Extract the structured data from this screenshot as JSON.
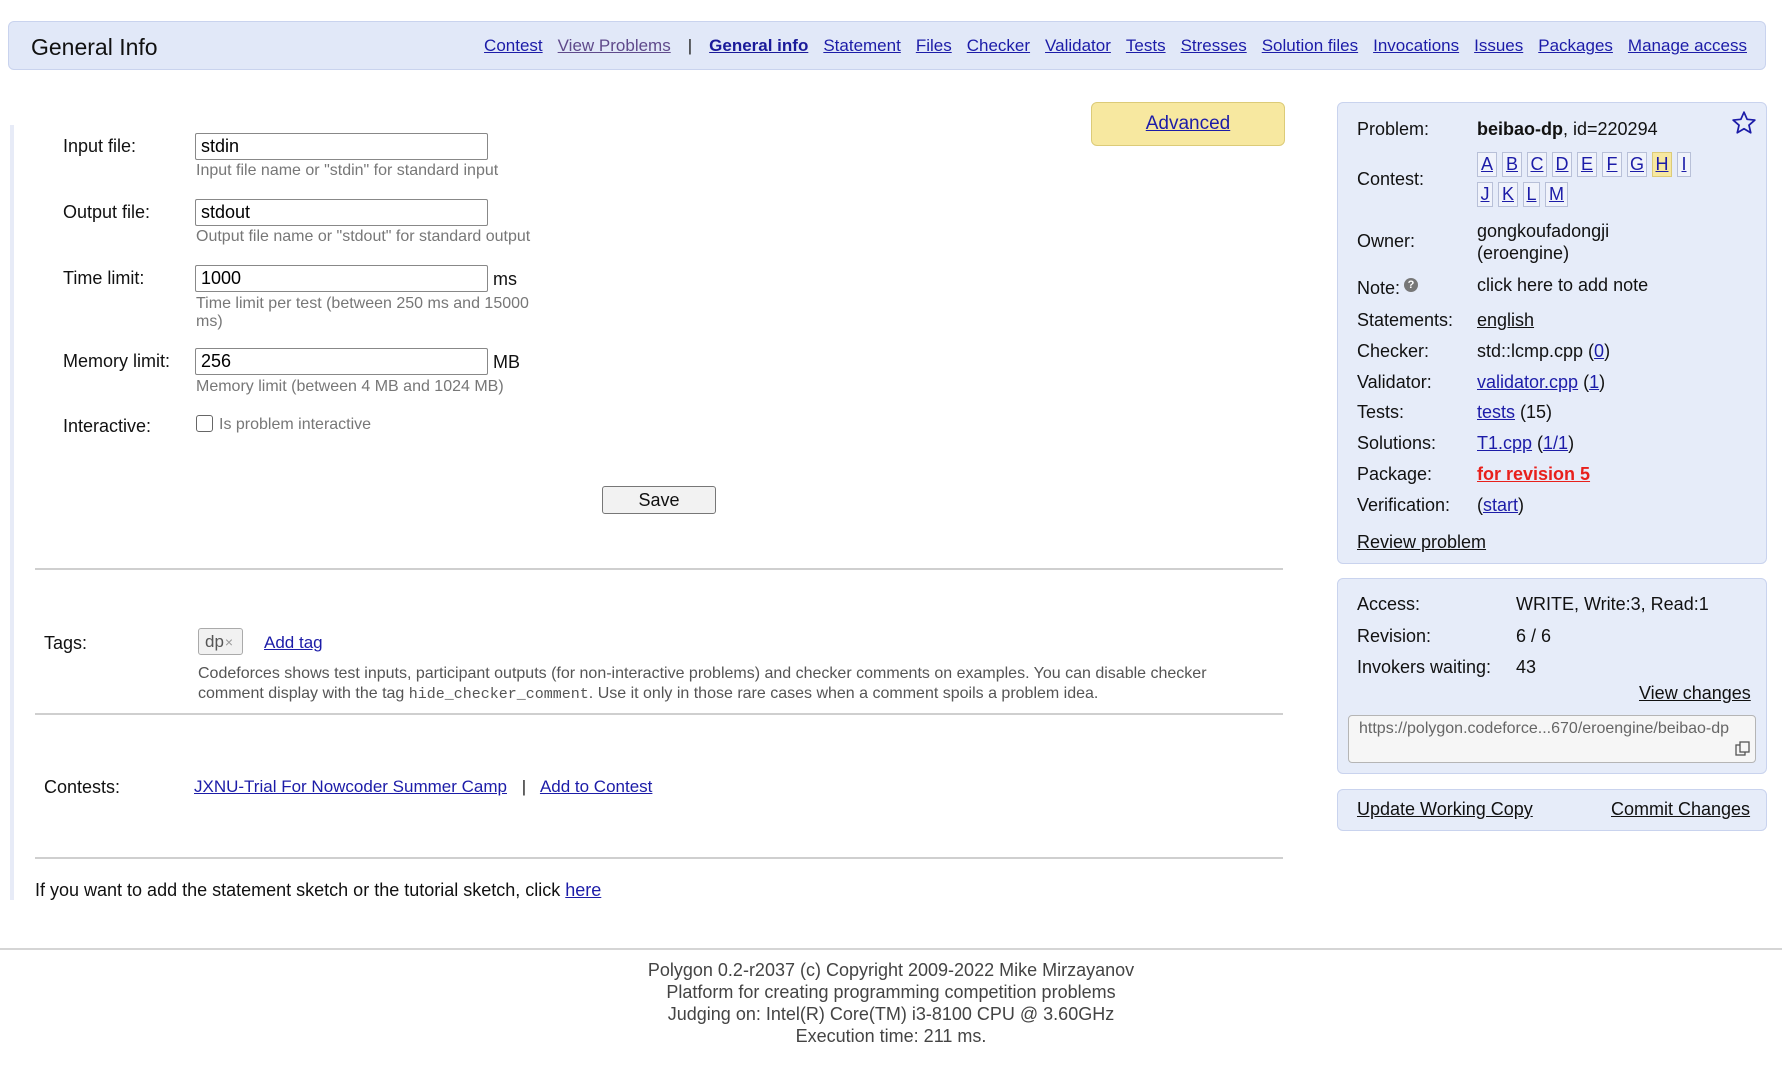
{
  "header": {
    "title": "General Info",
    "nav": {
      "contest": "Contest",
      "view_problems": "View Problems",
      "sep": "|",
      "general_info": "General info",
      "statement": "Statement",
      "files": "Files",
      "checker": "Checker",
      "validator": "Validator",
      "tests": "Tests",
      "stresses": "Stresses",
      "solution_files": "Solution files",
      "invocations": "Invocations",
      "issues": "Issues",
      "packages": "Packages",
      "manage_access": "Manage access"
    }
  },
  "advanced_label": "Advanced",
  "form": {
    "input_file": {
      "label": "Input file:",
      "value": "stdin",
      "hint": "Input file name or \"stdin\" for standard input"
    },
    "output_file": {
      "label": "Output file:",
      "value": "stdout",
      "hint": "Output file name or \"stdout\" for standard output"
    },
    "time_limit": {
      "label": "Time limit:",
      "value": "1000",
      "unit": "ms",
      "hint_line1": "Time limit per test (between 250 ms and 15000",
      "hint_line2": "ms)"
    },
    "memory_limit": {
      "label": "Memory limit:",
      "value": "256",
      "unit": "MB",
      "hint": "Memory limit (between 4 MB and 1024 MB)"
    },
    "interactive": {
      "label": "Interactive:",
      "checkbox_label": "Is problem interactive",
      "checked": false
    },
    "save_label": "Save"
  },
  "tags": {
    "label": "Tags:",
    "items": [
      {
        "name": "dp",
        "remove": "×"
      }
    ],
    "add_tag": "Add tag",
    "desc_before": "Codeforces shows test inputs, participant outputs (for non-interactive problems) and checker comments on examples. You can disable checker",
    "desc_line2_before": "comment display with the tag ",
    "desc_code": "hide_checker_comment",
    "desc_after": ". Use it only in those rare cases when a comment spoils a problem idea."
  },
  "contests": {
    "label": "Contests:",
    "contest_name": "JXNU-Trial For Nowcoder Summer Camp",
    "sep": "|",
    "add_to_contest": "Add to Contest"
  },
  "sketch": {
    "text": "If you want to add the statement sketch or the tutorial sketch, click ",
    "link": "here"
  },
  "sidebar": {
    "problem": {
      "label": "Problem:",
      "name": "beibao-dp",
      "id_text": ", id=220294"
    },
    "contest": {
      "label": "Contest:",
      "letters_row1": [
        "A",
        "B",
        "C",
        "D",
        "E",
        "F",
        "G",
        "H",
        "I"
      ],
      "letters_row2": [
        "J",
        "K",
        "L",
        "M"
      ],
      "current": "H"
    },
    "owner": {
      "label": "Owner:",
      "line1": "gongkoufadongji",
      "line2": "(eroengine)"
    },
    "note": {
      "label": "Note:",
      "help": "?",
      "link": "click here to add note"
    },
    "statements": {
      "label": "Statements:",
      "link": "english"
    },
    "checker": {
      "label": "Checker:",
      "text": "std::lcmp.cpp (",
      "link": "0",
      "close": ")"
    },
    "validator": {
      "label": "Validator:",
      "link": "validator.cpp",
      "open": " (",
      "count": "1",
      "close": ")"
    },
    "tests": {
      "label": "Tests:",
      "link": "tests",
      "rest": " (15)"
    },
    "solutions": {
      "label": "Solutions:",
      "link": "T1.cpp",
      "open": " (",
      "count": "1/1",
      "close": ")"
    },
    "package": {
      "label": "Package:",
      "link": "for revision 5"
    },
    "verification": {
      "label": "Verification:",
      "open": "(",
      "link": "start",
      "close": ")"
    },
    "review": "Review problem",
    "access": {
      "label": "Access:",
      "value": "WRITE, Write:3, Read:1"
    },
    "revision": {
      "label": "Revision:",
      "value": "6 / 6"
    },
    "invokers": {
      "label": "Invokers waiting:",
      "value": "43"
    },
    "view_changes": "View changes",
    "url": "https://polygon.codeforce...670/eroengine/beibao-dp",
    "update_working_copy": "Update Working Copy",
    "commit_changes": "Commit Changes"
  },
  "footer": {
    "line1": "Polygon 0.2-r2037 (c) Copyright 2009-2022 Mike Mirzayanov",
    "line2": "Platform for creating programming competition problems",
    "line3": "Judging on: Intel(R) Core(TM) i3-8100 CPU @ 3.60GHz",
    "line4": "Execution time: 211 ms."
  },
  "colors": {
    "header_bg": "#e1e8f8",
    "panel_bg": "#e6ecf9",
    "advanced_bg": "#f7e8a0",
    "package_red": "#e8201c",
    "link": "#1c1ca8"
  }
}
